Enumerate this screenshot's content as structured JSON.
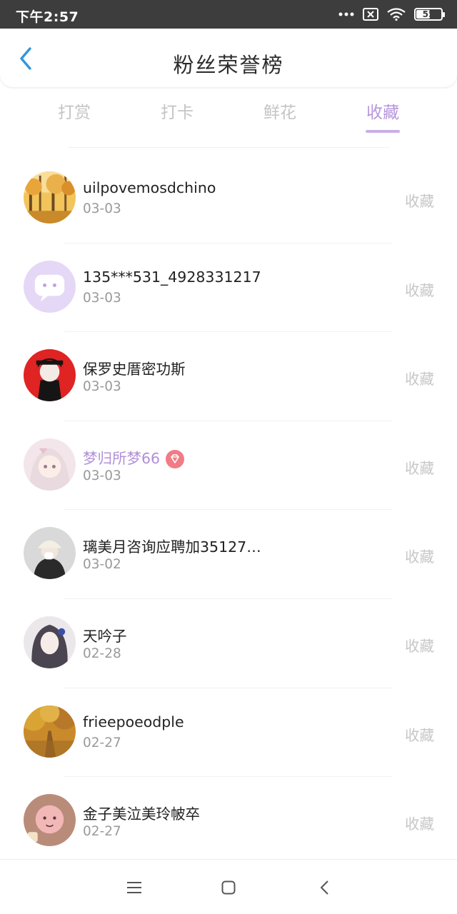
{
  "status_bar": {
    "time": "下午2:57",
    "battery": "55",
    "battery_level": 0.55
  },
  "header": {
    "title": "粉丝荣誉榜",
    "back_icon": "chevron-left-icon"
  },
  "tabs": [
    {
      "label": "打赏",
      "active": false
    },
    {
      "label": "打卡",
      "active": false
    },
    {
      "label": "鲜花",
      "active": false
    },
    {
      "label": "收藏",
      "active": true
    }
  ],
  "colors": {
    "accent": "#c9aee8",
    "accent_text": "#b695dc",
    "back_icon": "#2f96dc",
    "muted": "#c7c7c7"
  },
  "fans": [
    {
      "name": "uilpovemosdchino",
      "date": "03-03",
      "action": "收藏",
      "vip": false,
      "avatar_icon": "autumn-forest-avatar"
    },
    {
      "name": "135***531_4928331217",
      "date": "03-03",
      "action": "收藏",
      "vip": false,
      "avatar_icon": "chat-bubble-avatar"
    },
    {
      "name": "保罗史厝密功斯",
      "date": "03-03",
      "action": "收藏",
      "vip": false,
      "avatar_icon": "anime-boy-avatar"
    },
    {
      "name": "梦归所梦66",
      "date": "03-03",
      "action": "收藏",
      "vip": true,
      "avatar_icon": "anime-girl-avatar"
    },
    {
      "name": "璃美月咨询应聘加35127…",
      "date": "03-02",
      "action": "收藏",
      "vip": false,
      "avatar_icon": "girl-hat-avatar"
    },
    {
      "name": "天吟子",
      "date": "02-28",
      "action": "收藏",
      "vip": false,
      "avatar_icon": "painted-girl-avatar"
    },
    {
      "name": "frieepoeodple",
      "date": "02-27",
      "action": "收藏",
      "vip": false,
      "avatar_icon": "autumn-road-avatar"
    },
    {
      "name": "金子美泣美玲帔卒",
      "date": "02-27",
      "action": "收藏",
      "vip": false,
      "avatar_icon": "cartoon-baby-avatar"
    }
  ],
  "nav": {
    "menu_icon": "menu-icon",
    "home_icon": "home-square-icon",
    "back_icon": "back-triangle-icon"
  }
}
